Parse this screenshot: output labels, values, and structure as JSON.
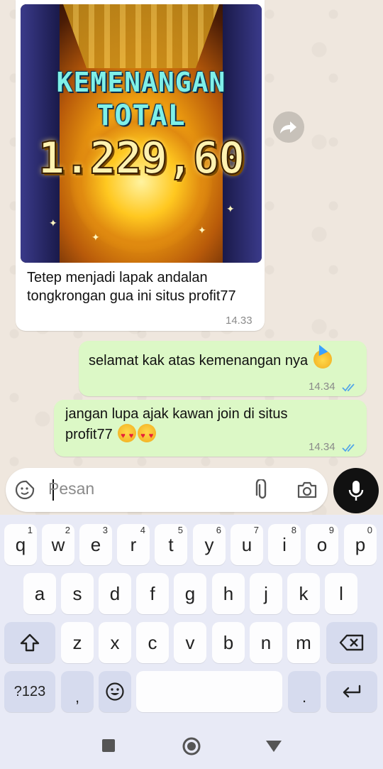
{
  "chat": {
    "incoming": {
      "media": {
        "title_line1": "KEMENANGAN",
        "title_line2": "TOTAL",
        "amount": "1.229,60"
      },
      "caption": "Tetep menjadi lapak andalan tongkrongan gua ini situs profit77",
      "time": "14.33"
    },
    "forward_icon": "forward-icon",
    "outgoing": [
      {
        "text": "selamat kak atas kemenangan nya",
        "emoji": "partying-face",
        "time": "14.34",
        "status": "read"
      },
      {
        "text_line1": "jangan lupa ajak kawan join di situs",
        "text_line2": "profit77",
        "emoji": "heart-eyes x2",
        "time": "14.34",
        "status": "read"
      }
    ]
  },
  "composer": {
    "placeholder": "Pesan",
    "icons": [
      "sticker-icon",
      "paperclip-icon",
      "camera-icon",
      "mic-icon"
    ]
  },
  "keyboard": {
    "row1": [
      {
        "k": "q",
        "n": "1"
      },
      {
        "k": "w",
        "n": "2"
      },
      {
        "k": "e",
        "n": "3"
      },
      {
        "k": "r",
        "n": "4"
      },
      {
        "k": "t",
        "n": "5"
      },
      {
        "k": "y",
        "n": "6"
      },
      {
        "k": "u",
        "n": "7"
      },
      {
        "k": "i",
        "n": "8"
      },
      {
        "k": "o",
        "n": "9"
      },
      {
        "k": "p",
        "n": "0"
      }
    ],
    "row2": [
      "a",
      "s",
      "d",
      "f",
      "g",
      "h",
      "j",
      "k",
      "l"
    ],
    "row3": [
      "z",
      "x",
      "c",
      "v",
      "b",
      "n",
      "m"
    ],
    "symbols_key": "?123",
    "comma_key": ",",
    "period_key": ".",
    "colors": {
      "background": "#e8eaf6",
      "key": "#fdfdfe",
      "function_key": "#d6dbee"
    }
  },
  "colors": {
    "outgoing_bubble": "#dcf8c6",
    "incoming_bubble": "#ffffff",
    "read_ticks": "#53a5e8"
  }
}
